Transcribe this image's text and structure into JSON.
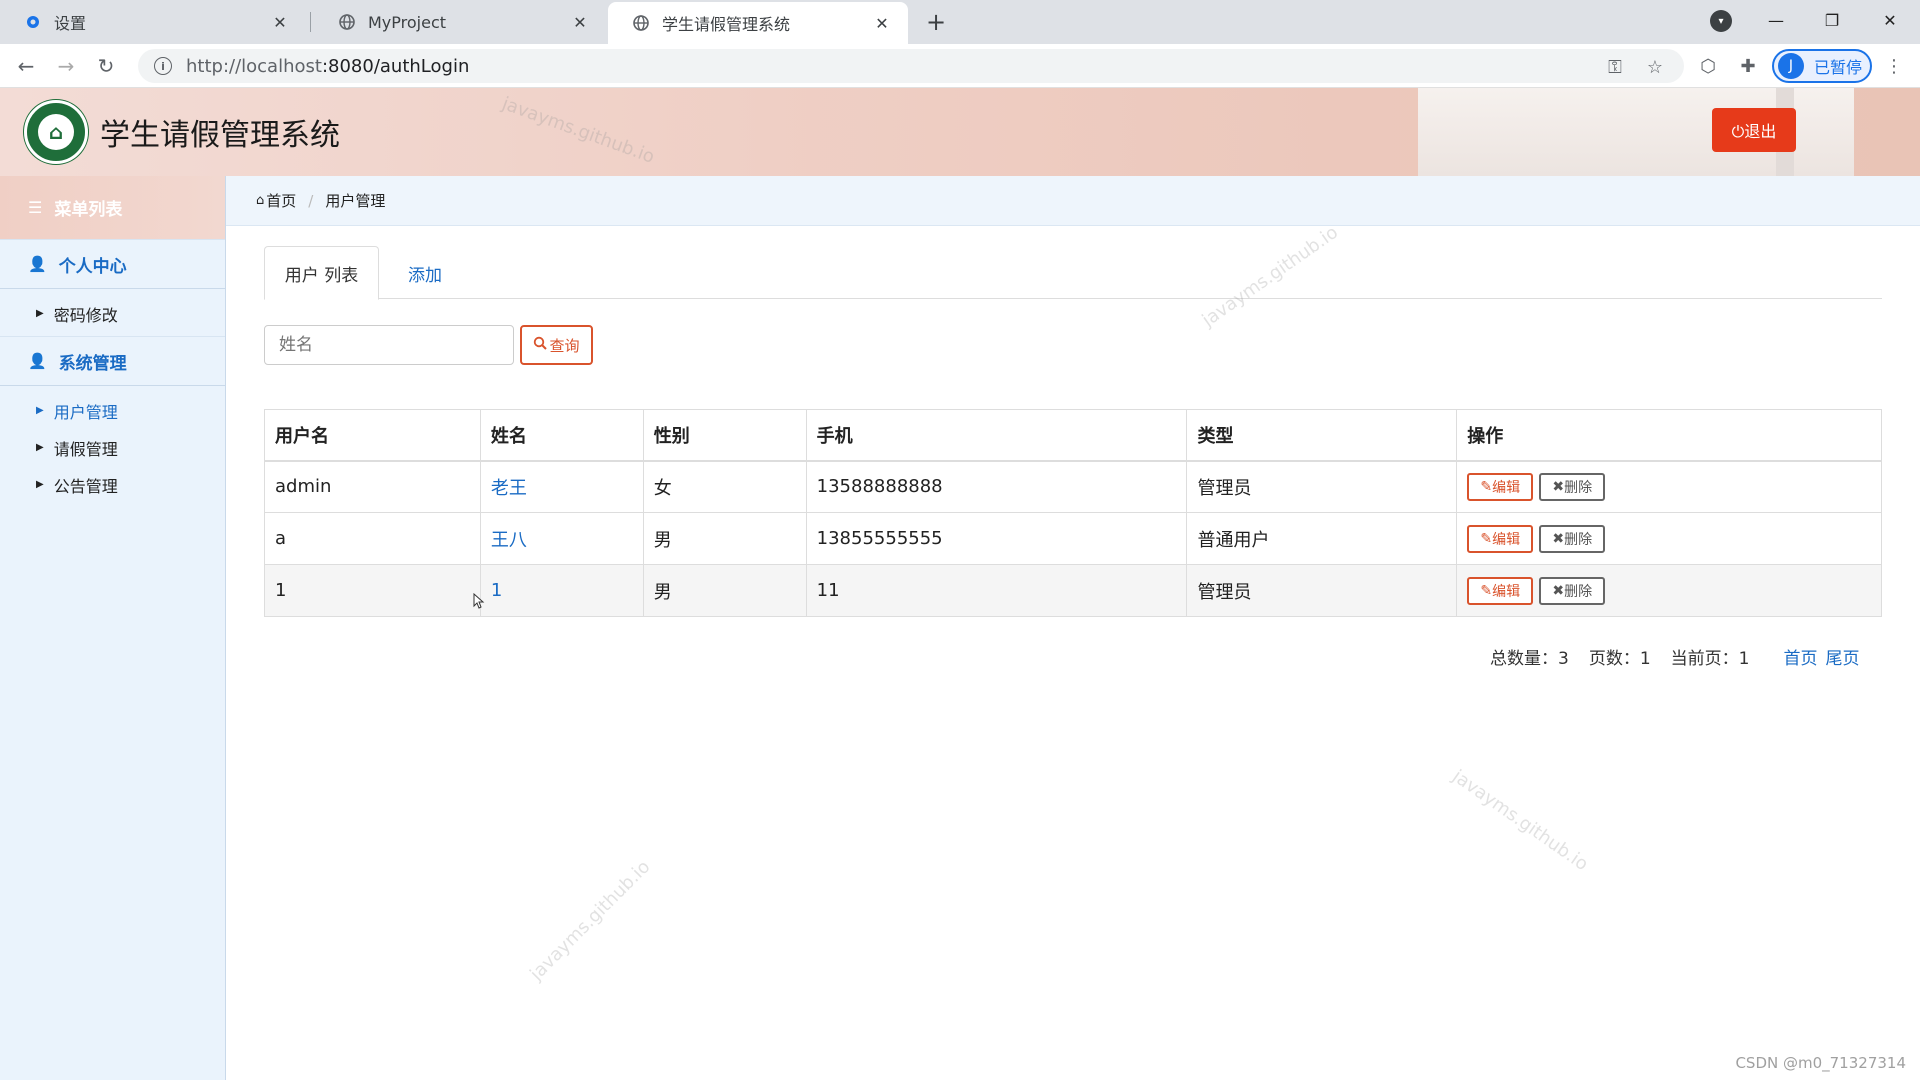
{
  "browser": {
    "tabs": [
      {
        "title": "设置",
        "icon": "gear-icon"
      },
      {
        "title": "MyProject",
        "icon": "globe-icon"
      },
      {
        "title": "学生请假管理系统",
        "icon": "globe-icon"
      }
    ],
    "url_host": "http://localhost",
    "url_rest": ":8080/authLogin",
    "profile_initial": "J",
    "profile_label": "已暂停"
  },
  "header": {
    "title": "学生请假管理系统",
    "logout_label": "⏻退出"
  },
  "sidebar": {
    "menu_title": "菜单列表",
    "groups": [
      {
        "label": "个人中心",
        "items": [
          {
            "label": "密码修改"
          }
        ]
      },
      {
        "label": "系统管理",
        "items": [
          {
            "label": "用户管理"
          },
          {
            "label": "请假管理"
          },
          {
            "label": "公告管理"
          }
        ]
      }
    ]
  },
  "breadcrumb": {
    "home": "首页",
    "current": "用户管理"
  },
  "tabs": {
    "list": "用户 列表",
    "add": "添加"
  },
  "search": {
    "placeholder": "姓名",
    "button": "查询"
  },
  "table": {
    "headers": [
      "用户名",
      "姓名",
      "性别",
      "手机",
      "类型",
      "操作"
    ],
    "rows": [
      {
        "username": "admin",
        "name": "老王",
        "gender": "女",
        "phone": "13588888888",
        "type": "管理员"
      },
      {
        "username": "a",
        "name": "王八",
        "gender": "男",
        "phone": "13855555555",
        "type": "普通用户"
      },
      {
        "username": "1",
        "name": "1",
        "gender": "男",
        "phone": "11",
        "type": "管理员"
      }
    ],
    "edit_label": "编辑",
    "delete_label": "删除"
  },
  "pager": {
    "total": "总数量：3",
    "pages": "页数：1",
    "current": "当前页：1",
    "first": "首页",
    "last": "尾页"
  },
  "watermark": "javayms.github.io",
  "footer_credit": "CSDN @m0_71327314",
  "colors": {
    "accent": "#1a6bc4",
    "danger": "#e63a1a",
    "sidebar_bg": "#eaf3fc"
  }
}
